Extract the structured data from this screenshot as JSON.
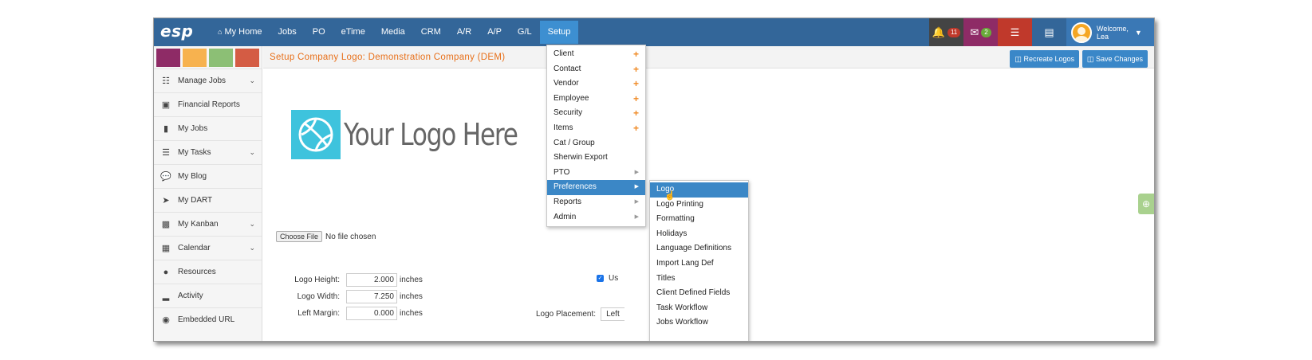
{
  "app": {
    "logo": "esp"
  },
  "nav": {
    "items": [
      {
        "label": "My Home",
        "icon": "home-icon"
      },
      {
        "label": "Jobs"
      },
      {
        "label": "PO"
      },
      {
        "label": "eTime"
      },
      {
        "label": "Media"
      },
      {
        "label": "CRM"
      },
      {
        "label": "A/R"
      },
      {
        "label": "A/P"
      },
      {
        "label": "G/L"
      },
      {
        "label": "Setup",
        "active": true
      }
    ]
  },
  "header_icons": {
    "notifications_count": "11",
    "messages_count": "2",
    "welcome_label": "Welcome,",
    "user_name": "Lea"
  },
  "colors": {
    "nav_bg": "#336699",
    "accent_orange": "#e8701a",
    "button_blue": "#3a87c8",
    "swatches": [
      "#8e2b66",
      "#f7b24f",
      "#8cbf75",
      "#d45c44"
    ],
    "icon_bells": "#444444",
    "icon_mail": "#8e2b66",
    "icon_db": "#c0392b",
    "icon_book": "#336699"
  },
  "sidebar": {
    "items": [
      {
        "label": "Manage Jobs",
        "icon": "sitemap-icon",
        "chevron": true
      },
      {
        "label": "Financial Reports",
        "icon": "report-icon",
        "chevron": false
      },
      {
        "label": "My Jobs",
        "icon": "folder-icon",
        "chevron": false
      },
      {
        "label": "My Tasks",
        "icon": "tasks-icon",
        "chevron": true
      },
      {
        "label": "My Blog",
        "icon": "comments-icon",
        "chevron": false
      },
      {
        "label": "My DART",
        "icon": "arrow-circle-icon",
        "chevron": false
      },
      {
        "label": "My Kanban",
        "icon": "map-icon",
        "chevron": true
      },
      {
        "label": "Calendar",
        "icon": "calendar-icon",
        "chevron": true
      },
      {
        "label": "Resources",
        "icon": "users-icon",
        "chevron": false
      },
      {
        "label": "Activity",
        "icon": "signal-icon",
        "chevron": false
      },
      {
        "label": "Embedded URL",
        "icon": "globe-icon",
        "chevron": false
      }
    ]
  },
  "page": {
    "title": "Setup Company Logo: Demonstration Company (DEM)",
    "recreate_logos": "Recreate Logos",
    "save_changes": "Save Changes",
    "logo_placeholder_text": "Your Logo Here",
    "choose_file": "Choose File",
    "no_file": "No file chosen",
    "logo_height_label": "Logo Height:",
    "logo_height": "2.000",
    "logo_width_label": "Logo Width:",
    "logo_width": "7.250",
    "left_margin_label": "Left Margin:",
    "left_margin": "0.000",
    "unit": "inches",
    "checkbox_label": "Us",
    "placement_label": "Logo Placement:",
    "placement_value": "Left"
  },
  "setup_menu": {
    "items": [
      {
        "label": "Client",
        "suffix": "plus"
      },
      {
        "label": "Contact",
        "suffix": "plus"
      },
      {
        "label": "Vendor",
        "suffix": "plus"
      },
      {
        "label": "Employee",
        "suffix": "plus"
      },
      {
        "label": "Security",
        "suffix": "plus"
      },
      {
        "label": "Items",
        "suffix": "plus"
      },
      {
        "label": "Cat / Group",
        "suffix": ""
      },
      {
        "label": "Sherwin Export",
        "suffix": ""
      },
      {
        "label": "PTO",
        "suffix": "arrow"
      },
      {
        "label": "Preferences",
        "suffix": "arrow",
        "highlight": true
      },
      {
        "label": "Reports",
        "suffix": "arrow"
      },
      {
        "label": "Admin",
        "suffix": "arrow"
      }
    ]
  },
  "preferences_menu": {
    "items": [
      {
        "label": "Logo",
        "highlight": true
      },
      {
        "label": "Logo Printing"
      },
      {
        "label": "Formatting"
      },
      {
        "label": "Holidays"
      },
      {
        "label": "Language Definitions"
      },
      {
        "label": "Import Lang Def"
      },
      {
        "label": "Titles"
      },
      {
        "label": "Client Defined Fields"
      },
      {
        "label": "Task Workflow"
      },
      {
        "label": "Jobs Workflow"
      }
    ]
  }
}
